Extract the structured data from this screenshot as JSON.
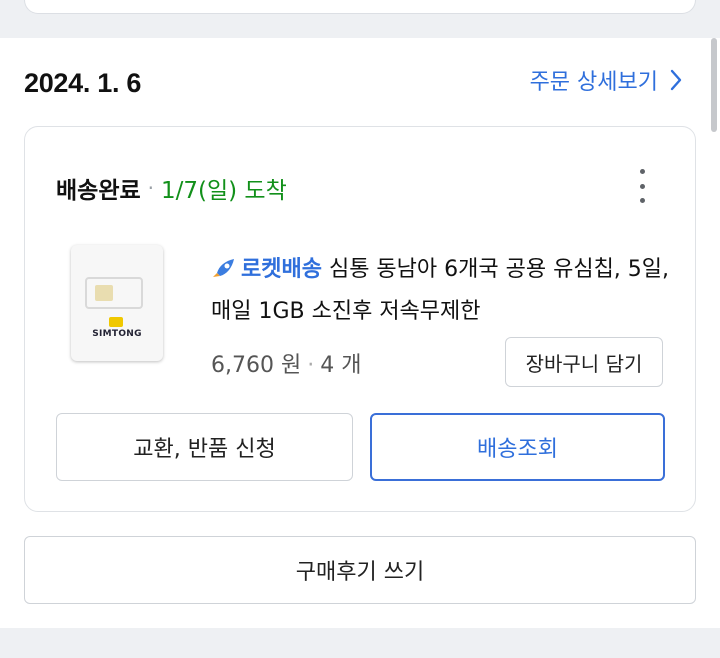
{
  "order": {
    "date": "2024. 1. 6",
    "detail_link": "주문 상세보기"
  },
  "status": {
    "label": "배송완료",
    "separator": "·",
    "arrival": "1/7(일) 도착"
  },
  "product": {
    "badge": "로켓배송",
    "name": " 심통 동남아 6개국 공용 유심칩, 5일, 매일 1GB 소진후 저속무제한",
    "thumbnail_text": "SIMTONG",
    "price": "6,760 원",
    "separator": "·",
    "quantity": "4 개"
  },
  "buttons": {
    "cart": "장바구니 담기",
    "exchange": "교환, 반품 신청",
    "track": "배송조회",
    "review": "구매후기 쓰기"
  },
  "colors": {
    "accent": "#2f6fdc",
    "arrival": "#12901a"
  },
  "icons": {
    "link": "chevron-right-icon",
    "menu": "more-vertical-icon",
    "badge": "rocket-icon"
  }
}
